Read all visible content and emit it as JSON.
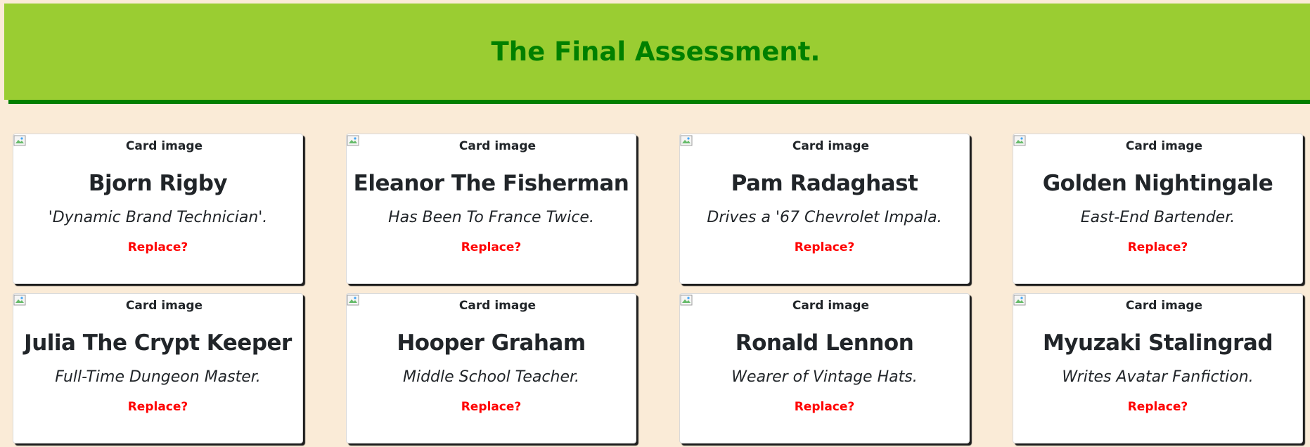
{
  "header": {
    "title": "The Final Assessment."
  },
  "cards": [
    {
      "img_alt": "Card image",
      "name": "Bjorn Rigby",
      "description": "'Dynamic Brand Technician'.",
      "action": "Replace?"
    },
    {
      "img_alt": "Card image",
      "name": "Eleanor The Fisherman",
      "description": "Has Been To France Twice.",
      "action": "Replace?"
    },
    {
      "img_alt": "Card image",
      "name": "Pam Radaghast",
      "description": "Drives a '67 Chevrolet Impala.",
      "action": "Replace?"
    },
    {
      "img_alt": "Card image",
      "name": "Golden Nightingale",
      "description": "East-End Bartender.",
      "action": "Replace?"
    },
    {
      "img_alt": "Card image",
      "name": "Julia The Crypt Keeper",
      "description": "Full-Time Dungeon Master.",
      "action": "Replace?"
    },
    {
      "img_alt": "Card image",
      "name": "Hooper Graham",
      "description": "Middle School Teacher.",
      "action": "Replace?"
    },
    {
      "img_alt": "Card image",
      "name": "Ronald Lennon",
      "description": "Wearer of Vintage Hats.",
      "action": "Replace?"
    },
    {
      "img_alt": "Card image",
      "name": "Myuzaki Stalingrad",
      "description": "Writes Avatar Fanfiction.",
      "action": "Replace?"
    }
  ],
  "colors": {
    "background": "#faebd7",
    "header_bg": "#9acd32",
    "header_text": "#008000",
    "link": "#ff0000"
  },
  "icons": {
    "card_image": "broken-image-icon"
  }
}
